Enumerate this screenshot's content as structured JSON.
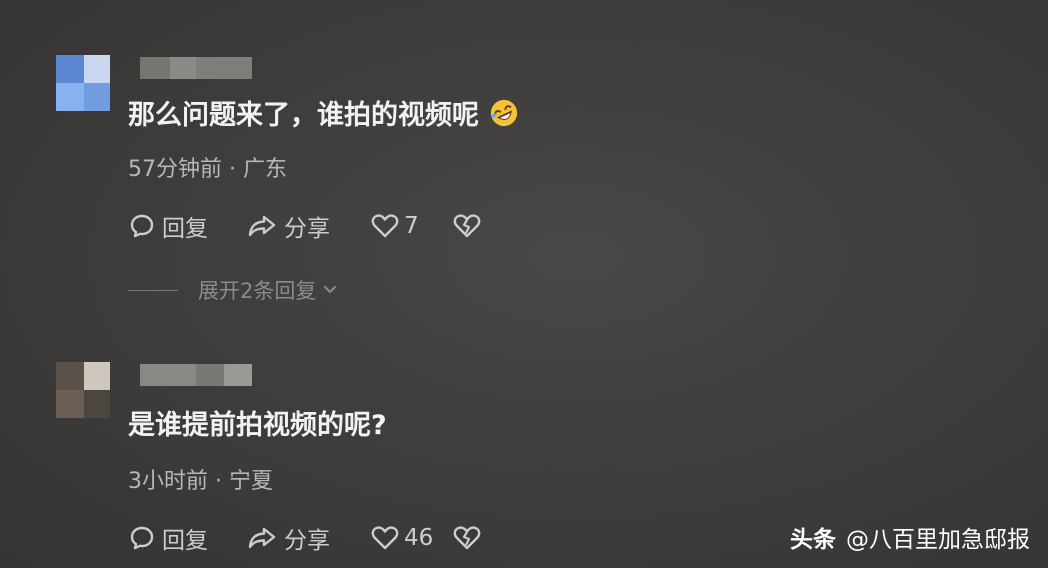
{
  "comments": [
    {
      "text": "那么问题来了，谁拍的视频呢",
      "emoji": "rolling-on-floor-laughing-emoji",
      "meta": "57分钟前 · 广东",
      "reply_label": "回复",
      "share_label": "分享",
      "like_count": "7",
      "expand_label": "展开2条回复"
    },
    {
      "text": "是谁提前拍视频的呢?",
      "meta": "3小时前 · 宁夏",
      "reply_label": "回复",
      "share_label": "分享",
      "like_count": "46"
    }
  ],
  "watermark": {
    "brand": "头条",
    "author": "@八百里加急邸报"
  },
  "colors": {
    "background": "#413f3d",
    "text_primary": "#f2f2f2",
    "text_meta": "#b9b7b4",
    "action": "#cfcdca",
    "avatar_blue": "#6f9de0",
    "emoji_yellow": "#f5c33b"
  }
}
